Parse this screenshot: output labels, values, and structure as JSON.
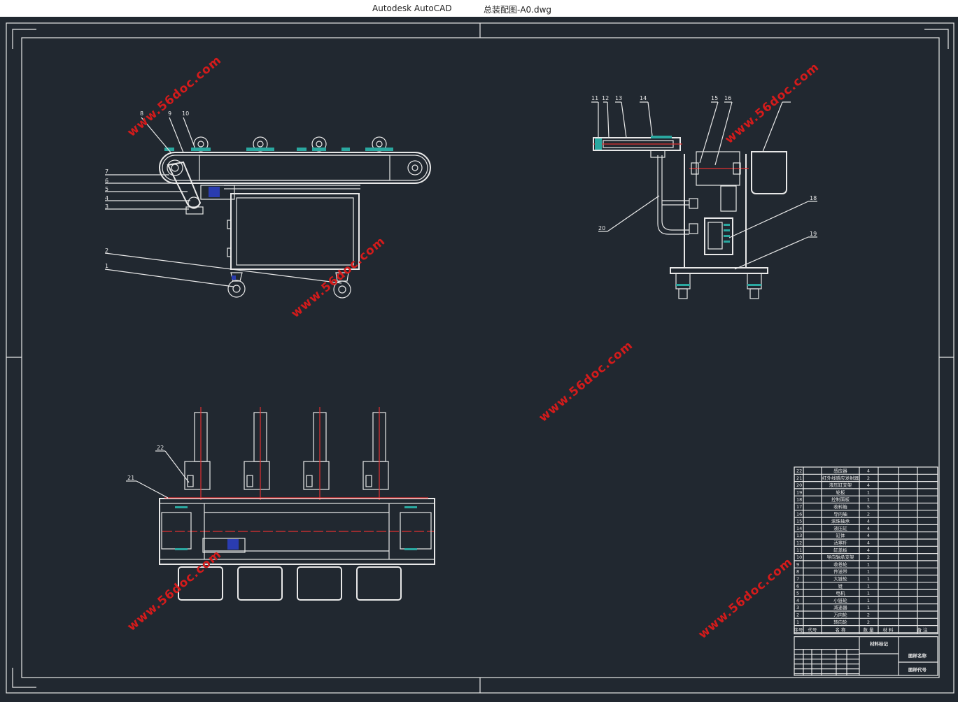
{
  "window": {
    "app_title": "Autodesk AutoCAD",
    "document_title": "总装配图-A0.dwg"
  },
  "watermark": "www.56doc.com",
  "colors": {
    "background": "#212830",
    "lines": "#e8e8e8",
    "centerline": "#e03030",
    "accent_cyan": "#2aa8a0",
    "accent_blue": "#2a3cb0"
  },
  "part_numbers": {
    "side_view": [
      "1",
      "2",
      "3",
      "4",
      "5",
      "6",
      "7",
      "8",
      "9",
      "10"
    ],
    "end_view": [
      "11",
      "12",
      "13",
      "14",
      "15",
      "16",
      "18",
      "19",
      "20"
    ],
    "plan_view": [
      "21",
      "22"
    ]
  },
  "bom": {
    "rows": [
      {
        "no": "22",
        "name": "感应器",
        "qty": "4"
      },
      {
        "no": "21",
        "name": "红外线感应发射器",
        "qty": "2"
      },
      {
        "no": "20",
        "name": "液压缸支架",
        "qty": "4"
      },
      {
        "no": "19",
        "name": "轮板",
        "qty": "1"
      },
      {
        "no": "18",
        "name": "控制面板",
        "qty": "1"
      },
      {
        "no": "17",
        "name": "收料箱",
        "qty": "5"
      },
      {
        "no": "16",
        "name": "导向轴",
        "qty": "2"
      },
      {
        "no": "15",
        "name": "滚珠轴承",
        "qty": "4"
      },
      {
        "no": "14",
        "name": "液压缸",
        "qty": "4"
      },
      {
        "no": "13",
        "name": "缸体",
        "qty": "4"
      },
      {
        "no": "12",
        "name": "活塞杆",
        "qty": "4"
      },
      {
        "no": "11",
        "name": "缸盖板",
        "qty": "4"
      },
      {
        "no": "10",
        "name": "导向轴承支架",
        "qty": "2"
      },
      {
        "no": "9",
        "name": "收卷轮",
        "qty": "1"
      },
      {
        "no": "8",
        "name": "传送带",
        "qty": "1"
      },
      {
        "no": "7",
        "name": "大链轮",
        "qty": "1"
      },
      {
        "no": "6",
        "name": "链",
        "qty": "1"
      },
      {
        "no": "5",
        "name": "电机",
        "qty": "1"
      },
      {
        "no": "4",
        "name": "小链轮",
        "qty": "1"
      },
      {
        "no": "3",
        "name": "减速器",
        "qty": "1"
      },
      {
        "no": "2",
        "name": "万向轮",
        "qty": "2"
      },
      {
        "no": "1",
        "name": "转向轮",
        "qty": "2"
      }
    ],
    "header": {
      "no": "序号",
      "code": "代号",
      "name": "名 称",
      "qty": "数 量",
      "material": "材 料",
      "remark": "备 注"
    },
    "title_block": {
      "material_mark": "材料标记",
      "drawing_name": "图样名称",
      "drawing_code": "图样代号"
    }
  }
}
